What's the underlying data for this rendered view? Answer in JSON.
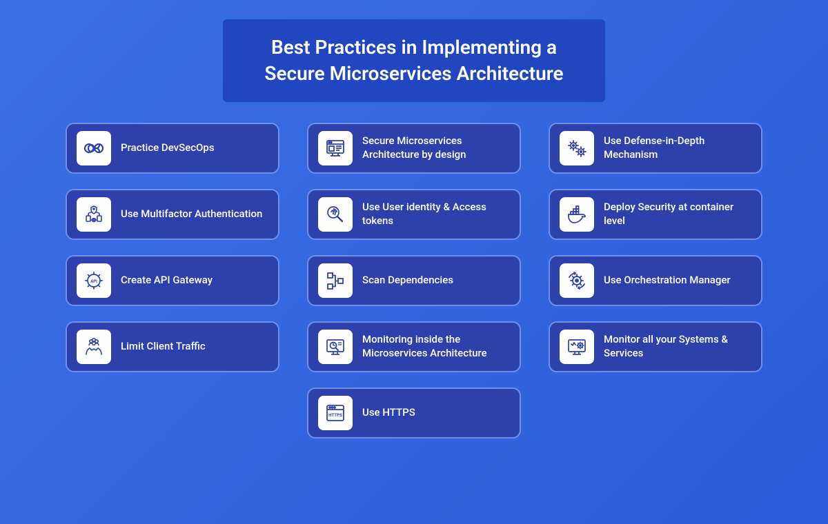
{
  "title_line1": "Best Practices in Implementing a",
  "title_line2": "Secure Microservices Architecture",
  "colors": {
    "bg_gradient_start": "#3B6FE5",
    "bg_gradient_end": "#2B5CD9",
    "title_bg": "#2146C0",
    "card_bg": "#2C41AC",
    "card_border": "#6F8FEB",
    "icon_bg": "#FFFFFF",
    "icon_stroke": "#2C41AC",
    "text": "#FFFFFF"
  },
  "cards": [
    {
      "icon": "infinity-icon",
      "label": "Practice DevSecOps"
    },
    {
      "icon": "design-monitor-icon",
      "label": "Secure Microservices Architecture by design"
    },
    {
      "icon": "gears-icon",
      "label": "Use Defense-in-Depth Mechanism"
    },
    {
      "icon": "mfa-icon",
      "label": "Use Multifactor Authentication"
    },
    {
      "icon": "fingerprint-icon",
      "label": "Use User identity & Access tokens"
    },
    {
      "icon": "container-icon",
      "label": "Deploy Security at container level"
    },
    {
      "icon": "api-gear-icon",
      "label": "Create API Gateway"
    },
    {
      "icon": "dependency-tree-icon",
      "label": "Scan Dependencies"
    },
    {
      "icon": "orchestration-gear-icon",
      "label": "Use Orchestration Manager"
    },
    {
      "icon": "hands-people-icon",
      "label": "Limit Client Traffic"
    },
    {
      "icon": "monitor-chart-icon",
      "label": "Monitoring inside the Microservices Architecture"
    },
    {
      "icon": "monitor-gear-icon",
      "label": "Monitor all your Systems & Services"
    },
    {
      "icon": "https-browser-icon",
      "label": "Use HTTPS"
    }
  ]
}
